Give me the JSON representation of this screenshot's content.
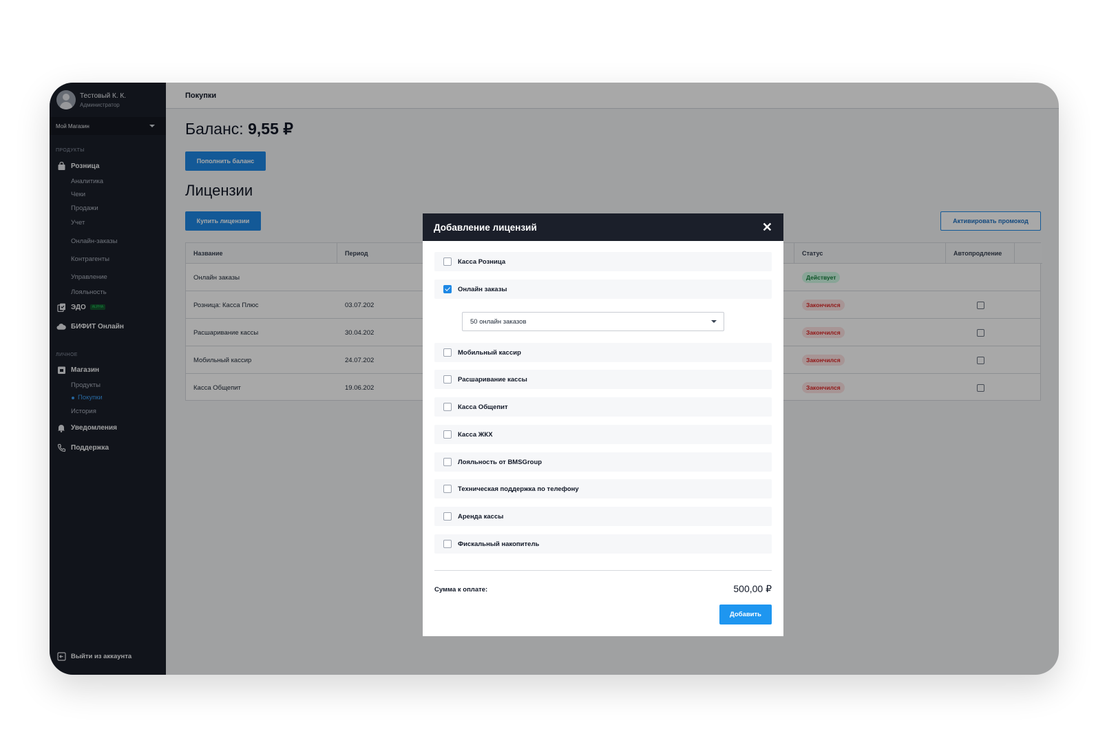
{
  "user": {
    "name": "Тестовый К. К.",
    "role": "Администратор"
  },
  "store_select": "Мой Магазин",
  "sidebar": {
    "section_products": "ПРОДУКТЫ",
    "retail": "Розница",
    "retail_items": [
      "Аналитика",
      "Чеки",
      "Продажи",
      "Учет",
      "Онлайн-заказы",
      "Контрагенты",
      "Управление",
      "Лояльность"
    ],
    "edo": "ЭДО",
    "edo_badge": "ALPHA",
    "bifit": "БИФИТ Онлайн",
    "section_personal": "ЛИЧНОЕ",
    "shop": "Магазин",
    "shop_items": [
      "Продукты",
      "Покупки",
      "История"
    ],
    "notifications": "Уведомления",
    "support": "Поддержка",
    "logout": "Выйти из аккаунта"
  },
  "header": {
    "title": "Покупки"
  },
  "balance": {
    "label": "Баланс:",
    "value": "9,55 ₽"
  },
  "buttons": {
    "topup": "Пополнить баланс",
    "buy": "Купить лицензии",
    "promo": "Активировать промокод"
  },
  "licenses_title": "Лицензии",
  "table": {
    "headers": [
      "Название",
      "Период",
      "Статус",
      "Автопродление"
    ],
    "rows": [
      {
        "name": "Онлайн заказы",
        "period": "",
        "status": "Действует",
        "status_type": "ok",
        "autorenew": false
      },
      {
        "name": "Розница: Касса Плюс",
        "period": "03.07.202",
        "status": "Закончился",
        "status_type": "end",
        "autorenew": true
      },
      {
        "name": "Расшаривание кассы",
        "period": "30.04.202",
        "status": "Закончился",
        "status_type": "end",
        "autorenew": true
      },
      {
        "name": "Мобильный кассир",
        "period": "24.07.202",
        "status": "Закончился",
        "status_type": "end",
        "autorenew": true
      },
      {
        "name": "Касса Общепит",
        "period": "19.06.202",
        "status": "Закончился",
        "status_type": "end",
        "autorenew": true
      }
    ]
  },
  "modal": {
    "title": "Добавление лицензий",
    "options": [
      {
        "label": "Касса Розница",
        "checked": false
      },
      {
        "label": "Онлайн заказы",
        "checked": true
      },
      {
        "label": "Мобильный кассир",
        "checked": false
      },
      {
        "label": "Расшаривание кассы",
        "checked": false
      },
      {
        "label": "Касса Общепит",
        "checked": false
      },
      {
        "label": "Касса ЖКХ",
        "checked": false
      },
      {
        "label": "Лояльность от BMSGroup",
        "checked": false
      },
      {
        "label": "Техническая поддержка по телефону",
        "checked": false
      },
      {
        "label": "Аренда кассы",
        "checked": false
      },
      {
        "label": "Фискальный накопитель",
        "checked": false
      }
    ],
    "select_value": "50 онлайн заказов",
    "sum_label": "Сумма к оплате:",
    "sum_value": "500,00 ₽",
    "add_button": "Добавить"
  },
  "colors": {
    "accent": "#1e88e5",
    "sidebar": "#1b1f2a",
    "status_ok": "#15803d",
    "status_end": "#dc2626"
  }
}
